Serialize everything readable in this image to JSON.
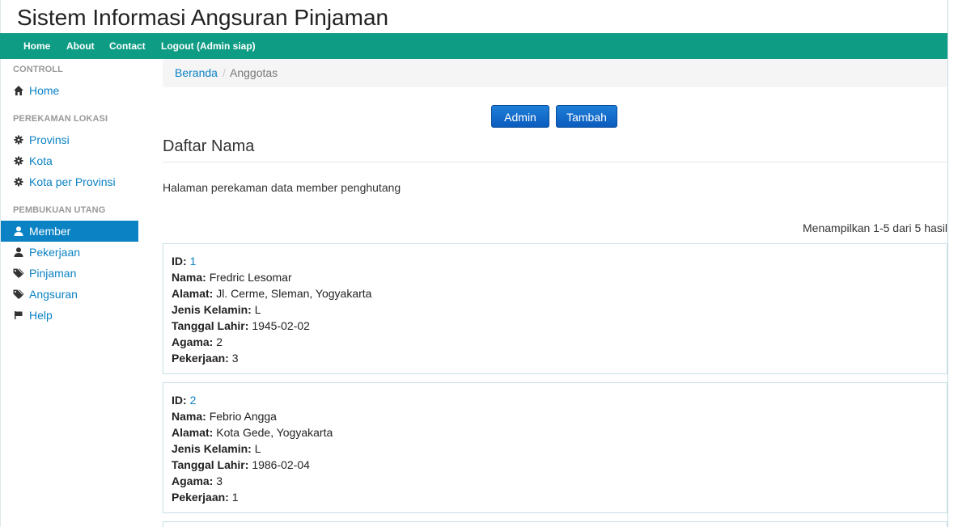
{
  "app": {
    "title": "Sistem Informasi Angsuran Pinjaman"
  },
  "navbar": {
    "items": [
      {
        "label": "Home"
      },
      {
        "label": "About"
      },
      {
        "label": "Contact"
      },
      {
        "label": "Logout (Admin siap)"
      }
    ]
  },
  "sidebar": {
    "sections": [
      {
        "header": "CONTROLL",
        "items": [
          {
            "label": "Home",
            "icon": "home-icon"
          }
        ]
      },
      {
        "header": "PEREKAMAN LOKASI",
        "items": [
          {
            "label": "Provinsi",
            "icon": "gear-icon"
          },
          {
            "label": "Kota",
            "icon": "gear-icon"
          },
          {
            "label": "Kota per Provinsi",
            "icon": "gear-icon"
          }
        ]
      },
      {
        "header": "PEMBUKUAN UTANG",
        "items": [
          {
            "label": "Member",
            "icon": "user-icon",
            "active": true
          },
          {
            "label": "Pekerjaan",
            "icon": "user-icon"
          },
          {
            "label": "Pinjaman",
            "icon": "tags-icon"
          },
          {
            "label": "Angsuran",
            "icon": "tags-icon"
          },
          {
            "label": "Help",
            "icon": "flag-icon"
          }
        ]
      }
    ]
  },
  "breadcrumb": {
    "home": "Beranda",
    "separator": "/",
    "current": "Anggotas"
  },
  "buttons": {
    "admin": "Admin",
    "tambah": "Tambah"
  },
  "main": {
    "title": "Daftar Nama",
    "description": "Halaman perekaman data member penghutang",
    "summary": "Menampilkan 1-5 dari 5 hasil"
  },
  "fields": {
    "id": "ID:",
    "nama": "Nama:",
    "alamat": "Alamat:",
    "jenis_kelamin": "Jenis Kelamin:",
    "tanggal_lahir": "Tanggal Lahir:",
    "agama": "Agama:",
    "pekerjaan": "Pekerjaan:"
  },
  "members": [
    {
      "id": "1",
      "nama": "Fredric Lesomar",
      "alamat": "Jl. Cerme, Sleman, Yogyakarta",
      "jenis_kelamin": "L",
      "tanggal_lahir": "1945-02-02",
      "agama": "2",
      "pekerjaan": "3"
    },
    {
      "id": "2",
      "nama": "Febrio Angga",
      "alamat": "Kota Gede, Yogyakarta",
      "jenis_kelamin": "L",
      "tanggal_lahir": "1986-02-04",
      "agama": "3",
      "pekerjaan": "1"
    }
  ],
  "colors": {
    "navbar": "#0e9c84",
    "link": "#0a82c4",
    "button": "#0b5bbd"
  }
}
